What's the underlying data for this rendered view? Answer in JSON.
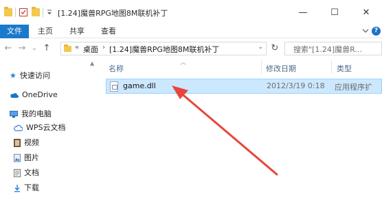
{
  "window": {
    "title": "[1.24]魔兽RPG地图8M联机补丁",
    "quick_access": [
      "folder-icon",
      "check-doc-icon",
      "folder-icon",
      "qa-dropdown-icon"
    ],
    "controls": {
      "minimize": "—",
      "maximize": "☐",
      "close": "✕"
    }
  },
  "ribbon": {
    "tabs": [
      {
        "label": "文件"
      },
      {
        "label": "主页"
      },
      {
        "label": "共享"
      },
      {
        "label": "查看"
      }
    ],
    "help": "?"
  },
  "address": {
    "back": "←",
    "forward": "→",
    "recent": "⌄",
    "up": "↑",
    "overflow": "«",
    "crumbs": [
      "桌面",
      "[1.24]魔兽RPG地图8M联机补丁"
    ],
    "search_placeholder": "搜索\"[1.24]魔兽R...",
    "refresh": "↻"
  },
  "sidebar": {
    "items": [
      {
        "label": "快速访问",
        "icon": "star-icon",
        "color": "#2b7cd3"
      },
      {
        "label": "OneDrive",
        "icon": "cloud-icon",
        "color": "#1a73c7"
      },
      {
        "label": "我的电脑",
        "icon": "computer-icon",
        "color": "#3d8ad8"
      },
      {
        "label": "WPS云文档",
        "icon": "wps-cloud-icon",
        "color": "#3a7bd5"
      },
      {
        "label": "视频",
        "icon": "video-folder-icon",
        "color": "#7a5a3a"
      },
      {
        "label": "图片",
        "icon": "picture-folder-icon",
        "color": "#4a7bb7"
      },
      {
        "label": "文档",
        "icon": "document-folder-icon",
        "color": "#6b6b6b"
      },
      {
        "label": "下载",
        "icon": "download-folder-icon",
        "color": "#2b7cd3"
      }
    ]
  },
  "content": {
    "columns": {
      "name": "名称",
      "modified": "修改日期",
      "type": "类型"
    },
    "files": [
      {
        "name": "game.dll",
        "modified": "2012/3/19 0:18",
        "type": "应用程序扩",
        "icon": "dll-file-icon"
      }
    ]
  },
  "colors": {
    "accent": "#1979ca",
    "selection": "#cce8ff",
    "selection_border": "#99d1ff",
    "annotation": "#e8453c"
  }
}
